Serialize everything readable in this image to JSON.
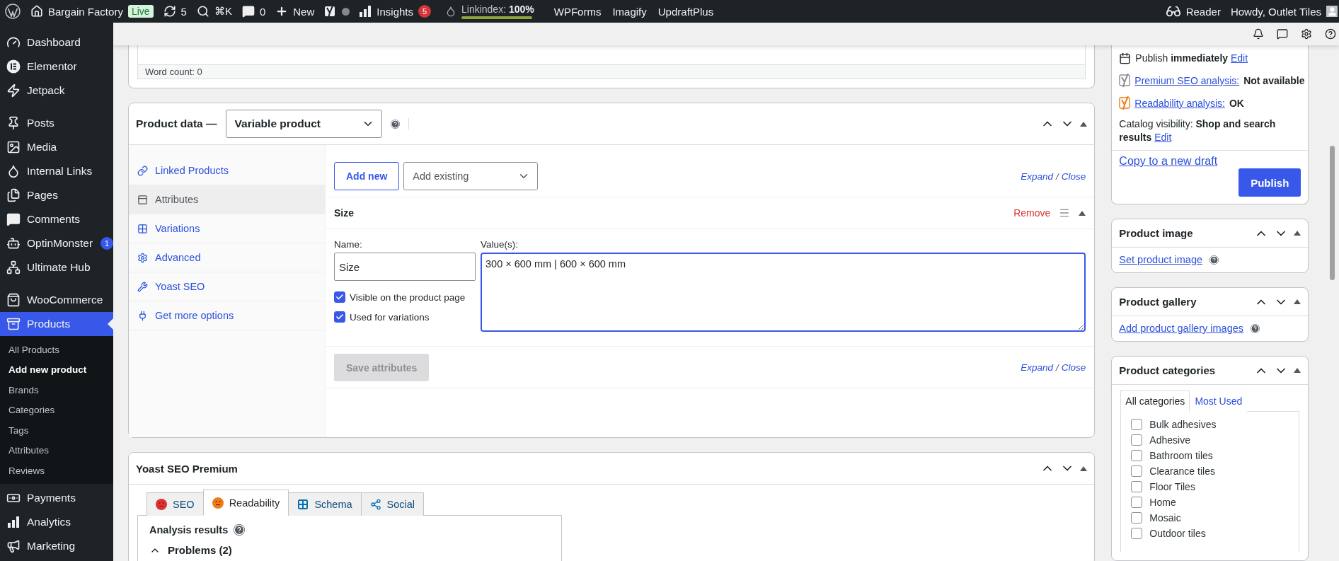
{
  "admin_bar": {
    "left": [
      {
        "kind": "wp-logo"
      },
      {
        "kind": "site",
        "label": "Bargain Factory",
        "badge": "Live"
      },
      {
        "kind": "updates",
        "label": "5"
      },
      {
        "kind": "search",
        "label": "⌘K"
      },
      {
        "kind": "comments",
        "label": "0"
      },
      {
        "kind": "new",
        "label": "New"
      },
      {
        "kind": "yoast"
      },
      {
        "kind": "insights",
        "label": "Insights",
        "badge": "5"
      },
      {
        "kind": "linkindex",
        "label": "Linkindex: **100%**",
        "level": 1
      },
      {
        "kind": "link",
        "label": "WPForms"
      },
      {
        "kind": "link",
        "label": "Imagify"
      },
      {
        "kind": "link",
        "label": "UpdraftPlus"
      }
    ],
    "right": [
      {
        "kind": "reader",
        "label": "Reader"
      },
      {
        "kind": "account",
        "label": "Howdy, Outlet Tiles"
      }
    ]
  },
  "sidebar": {
    "groups": [
      [
        {
          "label": "Dashboard",
          "selected": false
        },
        {
          "label": "Elementor",
          "selected": false
        },
        {
          "label": "Jetpack",
          "selected": false
        }
      ],
      [
        {
          "label": "Posts",
          "selected": false
        },
        {
          "label": "Media",
          "selected": false
        },
        {
          "label": "Internal Links",
          "selected": false
        },
        {
          "label": "Pages",
          "selected": false
        },
        {
          "label": "Comments",
          "selected": false
        },
        {
          "label": "OptinMonster",
          "selected": false,
          "badge": "1"
        },
        {
          "label": "Ultimate Hub",
          "selected": false
        }
      ],
      [
        {
          "label": "WooCommerce",
          "selected": false
        },
        {
          "label": "Products",
          "selected": true,
          "submenu": [
            {
              "label": "All Products",
              "selected": false
            },
            {
              "label": "Add new product",
              "selected": true
            },
            {
              "label": "Brands",
              "selected": false
            },
            {
              "label": "Categories",
              "selected": false
            },
            {
              "label": "Tags",
              "selected": false
            },
            {
              "label": "Attributes",
              "selected": false
            },
            {
              "label": "Reviews",
              "selected": false
            }
          ]
        }
      ],
      [
        {
          "label": "Payments",
          "selected": false
        },
        {
          "label": "Analytics",
          "selected": false
        },
        {
          "label": "Marketing",
          "selected": false
        }
      ]
    ]
  },
  "editor": {
    "word_count": "Word count: 0"
  },
  "product_data": {
    "title": "Product data —",
    "type": "Variable product",
    "tabs": [
      {
        "label": "Linked Products",
        "selected": false
      },
      {
        "label": "Attributes",
        "selected": true
      },
      {
        "label": "Variations",
        "selected": false
      },
      {
        "label": "Advanced",
        "selected": false
      },
      {
        "label": "Yoast SEO",
        "selected": false
      },
      {
        "label": "Get more options",
        "selected": false
      }
    ],
    "add_new": "Add new",
    "add_existing": "Add existing",
    "expand_links": [
      {
        "expand": "Expand",
        "separator": "/",
        "close": "Close"
      },
      {
        "expand": "Expand",
        "separator": "/",
        "close": "Close"
      }
    ],
    "attribute": {
      "heading": "Size",
      "remove": "Remove",
      "name_label": "Name:",
      "name_value": "Size",
      "values_label": "Value(s):",
      "values": "300 × 600 mm | 600 × 600 mm",
      "options": [
        {
          "label": "Visible on the product page",
          "checked": true
        },
        {
          "label": "Used for variations",
          "checked": true
        }
      ]
    },
    "save": {
      "label": "Save attributes",
      "disabled": true
    }
  },
  "yoast": {
    "title": "Yoast SEO Premium",
    "tabs": [
      {
        "kind": "seo",
        "label": "SEO",
        "selected": false
      },
      {
        "kind": "readability",
        "label": "Readability",
        "selected": true
      },
      {
        "kind": "schema",
        "label": "Schema",
        "selected": false
      },
      {
        "kind": "social",
        "label": "Social",
        "selected": false
      }
    ],
    "analysis_title": "Analysis results",
    "problems": {
      "label": "Problems (2)",
      "expanded": true
    }
  },
  "publish": {
    "schedule": "Publish **immediately**",
    "schedule_link": "Edit",
    "checks": [
      {
        "kind": "seo",
        "link": "Premium SEO analysis:",
        "value": "Not available"
      },
      {
        "kind": "readability",
        "link": "Readability analysis:",
        "value": "OK"
      }
    ],
    "visibility": "Catalog visibility: **Shop and search results**",
    "visibility_link": "Edit",
    "copy": "Copy to a new draft",
    "button": "Publish"
  },
  "product_image": {
    "title": "Product image",
    "link": "Set product image"
  },
  "product_gallery": {
    "title": "Product gallery",
    "link": "Add product gallery images"
  },
  "categories": {
    "title": "Product categories",
    "tabs": [
      {
        "label": "All categories",
        "selected": true
      },
      {
        "label": "Most Used",
        "selected": false
      }
    ],
    "items": [
      {
        "label": "Bulk adhesives",
        "checked": false
      },
      {
        "label": "Adhesive",
        "checked": false
      },
      {
        "label": "Bathroom tiles",
        "checked": false
      },
      {
        "label": "Clearance tiles",
        "checked": false
      },
      {
        "label": "Floor Tiles",
        "checked": false
      },
      {
        "label": "Home",
        "checked": false
      },
      {
        "label": "Mosaic",
        "checked": false
      },
      {
        "label": "Outdoor tiles",
        "checked": false
      }
    ]
  }
}
